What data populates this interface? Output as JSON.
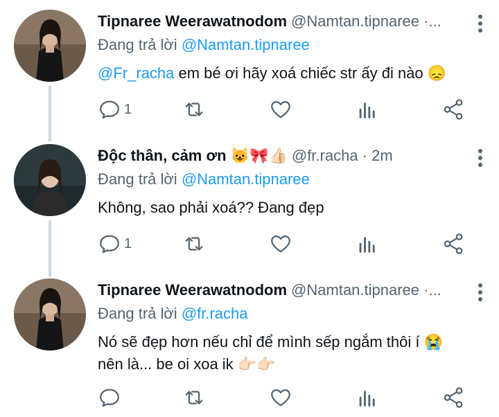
{
  "colors": {
    "accent": "#1d9bf0",
    "secondary": "#536471",
    "text": "#0f1419"
  },
  "replying_prefix": "Đang trả lời ",
  "tweets": [
    {
      "display_name": "Tipnaree Weerawatnodom",
      "handle": "@Namtan.tipnaree ·...",
      "reply_to": "@Namtan.tipnaree",
      "mention": "@Fr_racha",
      "text": " em bé ơi hãy xoá chiếc str ấy đi nào 😞",
      "reply_count": "1"
    },
    {
      "display_name": "Độc thân, cảm ơn 😺🎀👍🏻",
      "handle": "@fr.racha · 2m",
      "reply_to": "@Namtan.tipnaree",
      "text": "Không, sao phải xoá?? Đang đẹp",
      "reply_count": "1"
    },
    {
      "display_name": "Tipnaree Weerawatnodom",
      "handle": "@Namtan.tipnaree ·...",
      "reply_to": "@fr.racha",
      "text_line1": "Nó sẽ đẹp hơn nếu chỉ để mình sếp ngắm thôi í 😭",
      "text_line2": "nên là... be oi xoa ik 👉🏻👉🏻",
      "reply_count": ""
    }
  ],
  "icons": [
    "reply-icon",
    "retweet-icon",
    "like-icon",
    "analytics-icon",
    "share-icon",
    "more-icon"
  ]
}
